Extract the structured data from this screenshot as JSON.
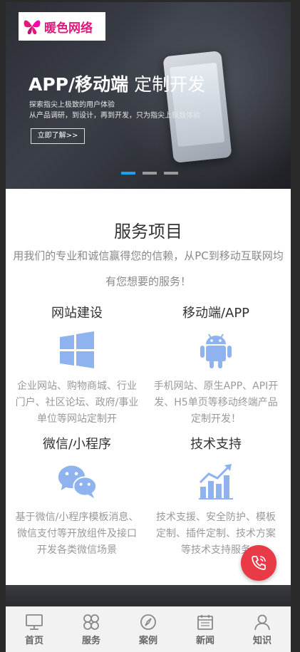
{
  "brand": {
    "logo_text": "暖色网络",
    "accent": "#e2197b"
  },
  "banner": {
    "title_bold": "APP/移动端",
    "title_thin": " 定制开发",
    "line1": "探索指尖上极致的用户体验",
    "line2": "从产品调研，到设计，再到开发，只为指尖上极致体验",
    "button": "立即了解>>",
    "slides": 3,
    "active_slide": 1
  },
  "services": {
    "title": "服务项目",
    "description": "用我们的专业和诚信赢得您的信赖，从PC到移动互联网均有您想要的服务！",
    "items": [
      {
        "title": "网站建设",
        "icon": "windows-icon",
        "desc": "企业网站、购物商城、行业门户、社区论坛、政府/事业单位等网站定制开"
      },
      {
        "title": "移动端/APP",
        "icon": "android-icon",
        "desc": "手机网站、原生APP、API开发、H5单页等移动终端产品定制开发！"
      },
      {
        "title": "微信/小程序",
        "icon": "wechat-icon",
        "desc": "基于微信/小程序模板消息、微信支付等开放组件及接口开发各类微信场景"
      },
      {
        "title": "技术支持",
        "icon": "chart-up-icon",
        "desc": "技术支援、安全防护、模板定制、插件定制、技术方案等技术支持服务"
      }
    ],
    "icon_color": "#8fb3ee"
  },
  "footer": {
    "tabs": [
      {
        "label": "首页",
        "icon": "monitor-icon"
      },
      {
        "label": "服务",
        "icon": "clover-icon"
      },
      {
        "label": "案例",
        "icon": "compass-icon"
      },
      {
        "label": "新闻",
        "icon": "calendar-icon"
      },
      {
        "label": "知识",
        "icon": "person-icon"
      }
    ]
  },
  "call_button": {
    "icon": "phone-icon",
    "color": "#e83b47"
  }
}
